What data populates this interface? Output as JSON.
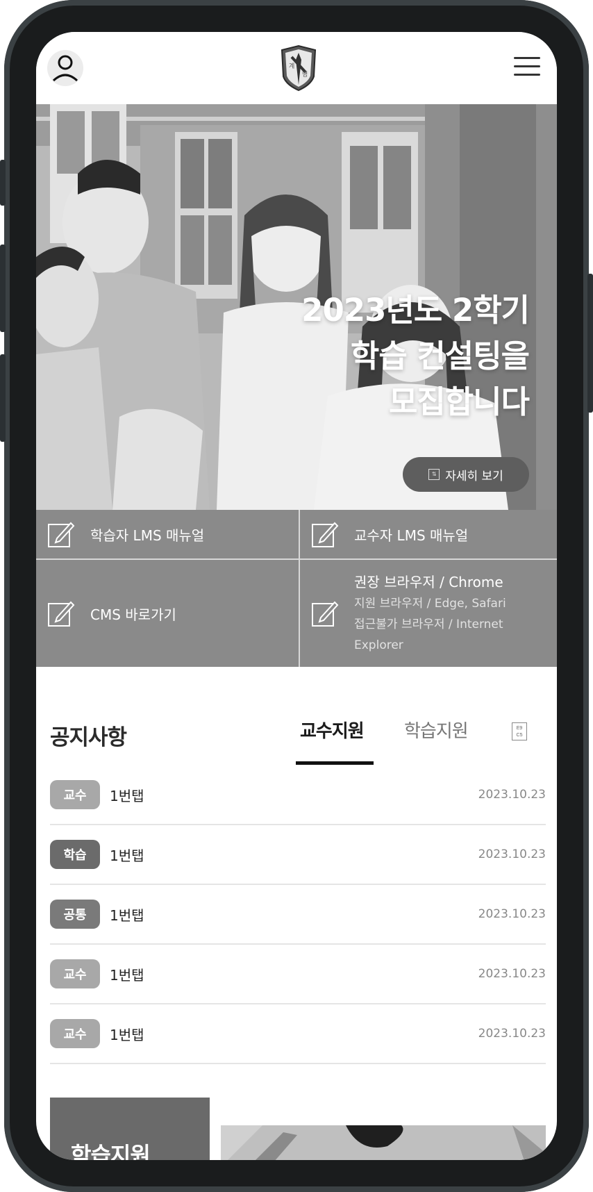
{
  "header": {
    "logo_text_top": "계",
    "logo_text_bottom": "명"
  },
  "hero": {
    "title_line1": "2023년도 2학기",
    "title_line2": "학습 컨설팅을",
    "title_line3": "모집합니다",
    "detail_button": "자세히 보기"
  },
  "quick_links": {
    "learner_manual": "학습자 LMS 매뉴얼",
    "professor_manual": "교수자 LMS 매뉴얼",
    "cms_shortcut": "CMS 바로가기",
    "browser": {
      "recommended": "권장 브라우저 / Chrome",
      "supported": "지원 브라우저 / Edge, Safari",
      "unsupported_line1": "접근불가 브라우저 / Internet",
      "unsupported_line2": "Explorer"
    }
  },
  "notice": {
    "title": "공지사항",
    "tabs": [
      {
        "label": "교수지원",
        "active": true
      },
      {
        "label": "학습지원",
        "active": false
      }
    ],
    "items": [
      {
        "badge": "교수",
        "badge_color": "#a8a8a8",
        "text": "1번탭",
        "date": "2023.10.23"
      },
      {
        "badge": "학습",
        "badge_color": "#6b6b6b",
        "text": "1번탭",
        "date": "2023.10.23"
      },
      {
        "badge": "공통",
        "badge_color": "#7a7a7a",
        "text": "1번탭",
        "date": "2023.10.23"
      },
      {
        "badge": "교수",
        "badge_color": "#a8a8a8",
        "text": "1번탭",
        "date": "2023.10.23"
      },
      {
        "badge": "교수",
        "badge_color": "#a8a8a8",
        "text": "1번탭",
        "date": "2023.10.23"
      }
    ]
  },
  "bottom": {
    "card_title": "학습지원"
  },
  "colors": {
    "quick_bg": "#8a8a8a",
    "tab_active": "#111111"
  }
}
